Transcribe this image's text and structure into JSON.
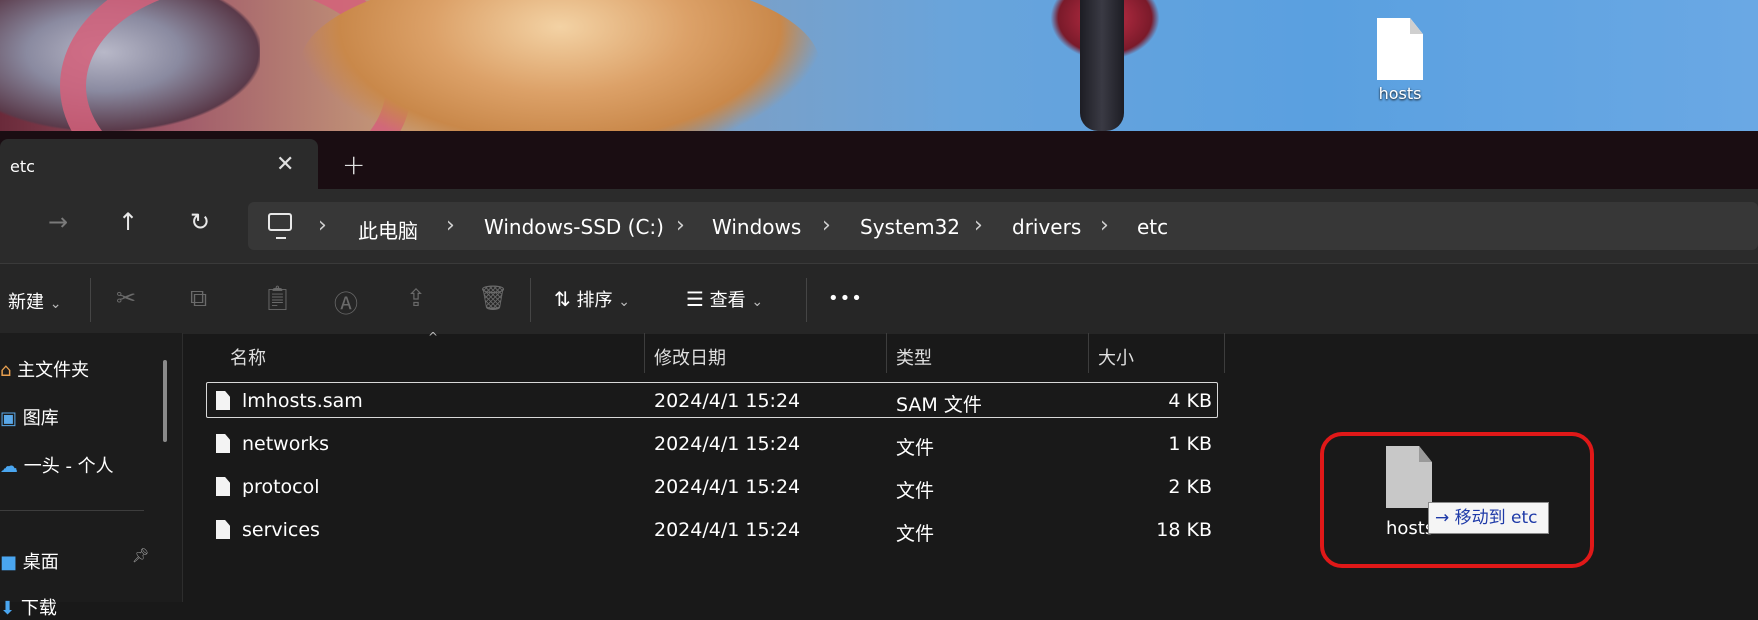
{
  "desktop": {
    "file_label": "hosts"
  },
  "tab": {
    "title": "etc",
    "close_glyph": "✕",
    "add_glyph": "+"
  },
  "nav": {
    "forward_glyph": "→",
    "up_glyph": "↑",
    "refresh_glyph": "↻"
  },
  "breadcrumb": {
    "separator": "›",
    "items": [
      "此电脑",
      "Windows-SSD (C:)",
      "Windows",
      "System32",
      "drivers",
      "etc"
    ]
  },
  "toolbar": {
    "new_label": "新建",
    "sort_label": "排序",
    "view_label": "查看",
    "more_glyph": "•••",
    "dropdown_glyph": "⌄",
    "cut_icon": "scissors-icon",
    "copy_icon": "copy-icon",
    "paste_icon": "clipboard-icon",
    "rename_icon": "rename-icon",
    "share_icon": "share-icon",
    "delete_icon": "trash-icon"
  },
  "sidebar": {
    "items": [
      {
        "label": "主文件夹",
        "icon": "home-icon"
      },
      {
        "label": "图库",
        "icon": "gallery-icon"
      },
      {
        "label": "一头 - 个人",
        "icon": "cloud-icon"
      },
      {
        "label": "桌面",
        "icon": "desktop-icon"
      },
      {
        "label": "下载",
        "icon": "download-icon"
      }
    ]
  },
  "columns": {
    "name": "名称",
    "date": "修改日期",
    "type": "类型",
    "size": "大小"
  },
  "files": [
    {
      "name": "lmhosts.sam",
      "date": "2024/4/1 15:24",
      "type": "SAM 文件",
      "size": "4 KB",
      "selected": true
    },
    {
      "name": "networks",
      "date": "2024/4/1 15:24",
      "type": "文件",
      "size": "1 KB",
      "selected": false
    },
    {
      "name": "protocol",
      "date": "2024/4/1 15:24",
      "type": "文件",
      "size": "2 KB",
      "selected": false
    },
    {
      "name": "services",
      "date": "2024/4/1 15:24",
      "type": "文件",
      "size": "18 KB",
      "selected": false
    }
  ],
  "drag": {
    "file_label": "hosts",
    "tooltip": "→ 移动到 etc"
  },
  "colors": {
    "highlight_box": "#e01818",
    "background": "#191919",
    "tooltip_text": "#1e3aa8"
  }
}
